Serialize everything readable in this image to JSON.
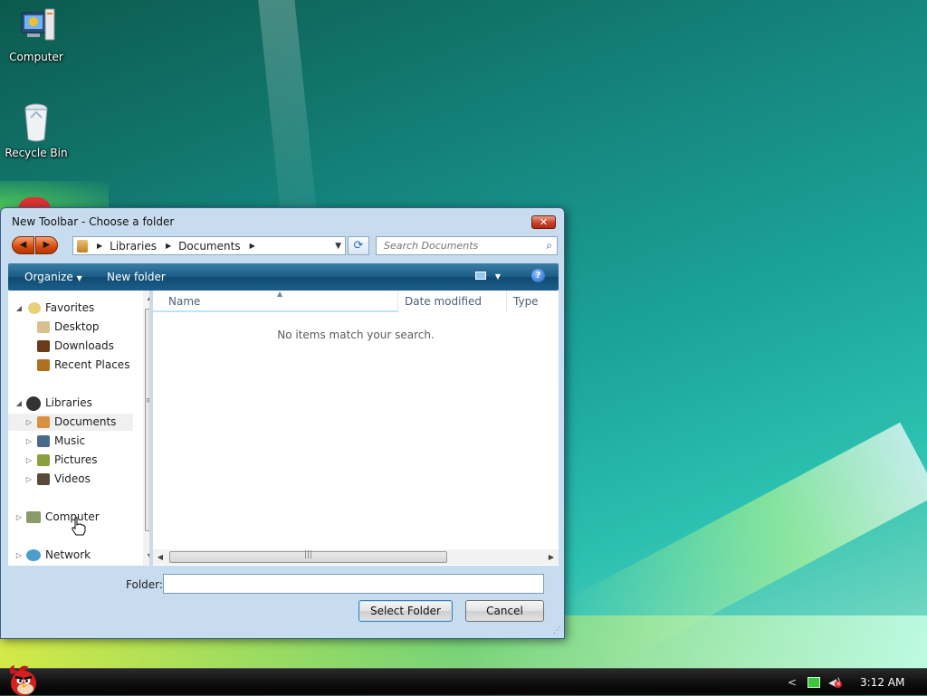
{
  "desktop": {
    "icons": [
      {
        "label": "Computer"
      },
      {
        "label": "Recycle Bin"
      }
    ]
  },
  "dialog": {
    "title": "New Toolbar - Choose a folder",
    "close_symbol": "✕",
    "address": {
      "crumbs": [
        "Libraries",
        "Documents"
      ]
    },
    "search": {
      "placeholder": "Search Documents"
    },
    "commands": {
      "organize": "Organize",
      "new_folder": "New folder"
    },
    "nav": {
      "favorites": {
        "label": "Favorites",
        "items": [
          "Desktop",
          "Downloads",
          "Recent Places"
        ]
      },
      "libraries": {
        "label": "Libraries",
        "items": [
          "Documents",
          "Music",
          "Pictures",
          "Videos"
        ],
        "selected": "Documents"
      },
      "computer": "Computer",
      "network": "Network"
    },
    "columns": {
      "name": "Name",
      "date": "Date modified",
      "type": "Type"
    },
    "empty_message": "No items match your search.",
    "folder_label": "Folder:",
    "folder_value": "",
    "buttons": {
      "select": "Select Folder",
      "cancel": "Cancel"
    }
  },
  "taskbar": {
    "clock": "3:12 AM"
  },
  "colors": {
    "accent": "#1a5a84",
    "nav_orange": "#d8490d",
    "close_red": "#c6412a"
  }
}
